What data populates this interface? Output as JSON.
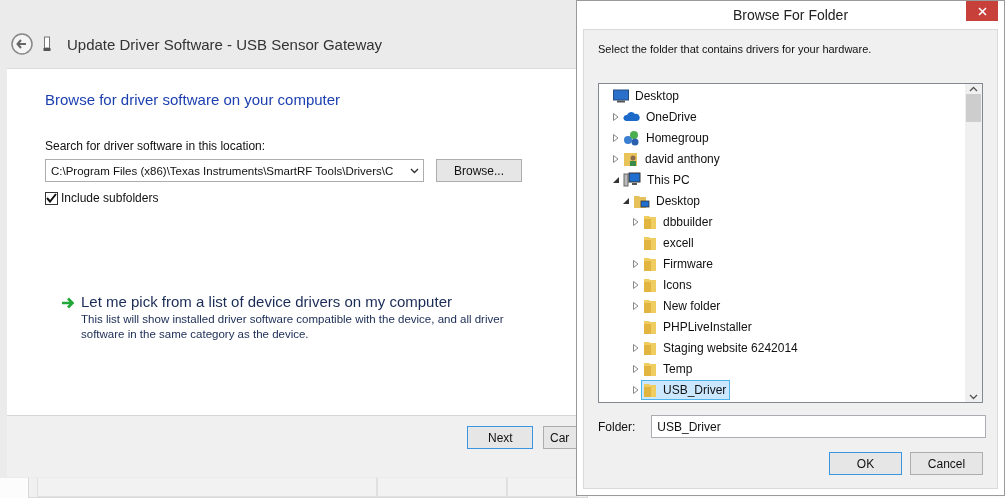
{
  "wizard": {
    "title": "Update Driver Software - USB Sensor Gateway",
    "heading": "Browse for driver software on your computer",
    "location_label": "Search for driver software in this location:",
    "location_value": "C:\\Program Files (x86)\\Texas Instruments\\SmartRF Tools\\Drivers\\C",
    "browse_button": "Browse...",
    "include_subfolders": {
      "label": "Include subfolders",
      "checked": true
    },
    "pick_option": {
      "title": "Let me pick from a list of device drivers on my computer",
      "description": "This list will show installed driver software compatible with the device, and all driver software in the same category as the device."
    },
    "buttons": [
      {
        "label": "Next",
        "default": true
      },
      {
        "label": "Car",
        "default": false
      }
    ]
  },
  "dialog": {
    "title": "Browse For Folder",
    "instruction": "Select the folder that contains drivers for your hardware.",
    "tree": [
      {
        "label": "Desktop",
        "kind": "desktop",
        "selected": false,
        "children": [
          {
            "label": "OneDrive",
            "kind": "cloud",
            "expanded": false,
            "selected": false
          },
          {
            "label": "Homegroup",
            "kind": "homegroup",
            "expanded": false,
            "selected": false
          },
          {
            "label": "david anthony",
            "kind": "user",
            "expanded": false,
            "selected": false
          },
          {
            "label": "This PC",
            "kind": "pc",
            "expanded": true,
            "selected": false,
            "children": [
              {
                "label": "Desktop",
                "kind": "desktop-folder",
                "expanded": true,
                "selected": false,
                "children": [
                  {
                    "label": "dbbuilder",
                    "kind": "folder",
                    "expanded": false,
                    "selected": false
                  },
                  {
                    "label": "excell",
                    "kind": "folder",
                    "selected": false
                  },
                  {
                    "label": "Firmware",
                    "kind": "folder",
                    "expanded": false,
                    "selected": false
                  },
                  {
                    "label": "Icons",
                    "kind": "folder",
                    "expanded": false,
                    "selected": false
                  },
                  {
                    "label": "New folder",
                    "kind": "folder",
                    "expanded": false,
                    "selected": false
                  },
                  {
                    "label": "PHPLiveInstaller",
                    "kind": "folder",
                    "selected": false
                  },
                  {
                    "label": "Staging website 6242014",
                    "kind": "folder",
                    "expanded": false,
                    "selected": false
                  },
                  {
                    "label": "Temp",
                    "kind": "folder",
                    "expanded": false,
                    "selected": false
                  },
                  {
                    "label": "USB_Driver",
                    "kind": "folder",
                    "expanded": false,
                    "selected": true
                  }
                ]
              }
            ]
          }
        ]
      }
    ],
    "folder_label": "Folder:",
    "folder_value": "USB_Driver",
    "buttons": [
      {
        "label": "OK",
        "default": true
      },
      {
        "label": "Cancel",
        "default": false
      }
    ]
  }
}
